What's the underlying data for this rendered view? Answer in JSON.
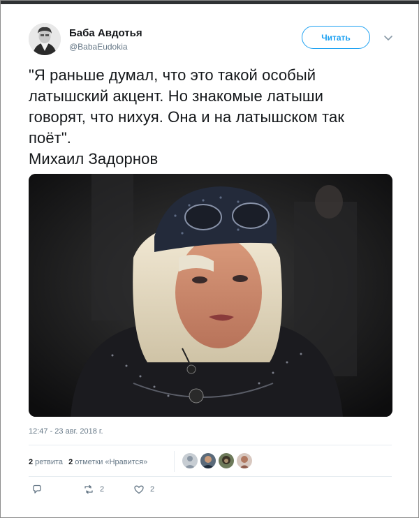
{
  "user": {
    "name": "Баба Авдотья",
    "handle": "@BabaEudokia"
  },
  "follow_label": "Читать",
  "tweet": {
    "text": "\"Я раньше думал, что это такой особый\nлатышский акцент. Но знакомые латыши\nговорят, что нихуя. Она и на латышском так\nпоёт\".\nМихаил Задорнов"
  },
  "timestamp": "12:47 - 23 авг. 2018 г.",
  "stats": {
    "retweets_count": "2",
    "retweets_label": "ретвита",
    "likes_count": "2",
    "likes_label": "отметки «Нравится»"
  },
  "actions": {
    "retweet_count": "2",
    "like_count": "2"
  },
  "icons": [
    "avatar",
    "chevron-down-icon",
    "reply-icon",
    "retweet-icon",
    "heart-icon"
  ],
  "colors": {
    "accent": "#1da1f2",
    "text": "#14171a",
    "muted": "#657786"
  }
}
